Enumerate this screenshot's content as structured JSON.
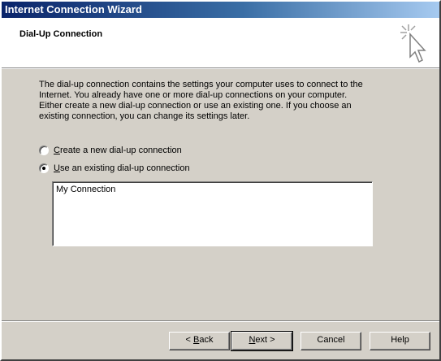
{
  "window": {
    "title": "Internet Connection Wizard"
  },
  "header": {
    "title": "Dial-Up Connection",
    "icon": "wizard-cursor-icon"
  },
  "intro": {
    "text": "The dial-up connection contains the settings your computer uses to connect to the Internet. You already have one or more dial-up connections on your computer. Either create a new dial-up connection or use an existing one. If you choose an existing connection, you can change its settings later."
  },
  "options": [
    {
      "accel": "C",
      "rest": "reate a new dial-up connection",
      "checked": false
    },
    {
      "accel": "U",
      "rest": "se an existing dial-up connection",
      "checked": true
    }
  ],
  "connections": [
    "My Connection"
  ],
  "buttons": {
    "back_prefix": "< ",
    "back_accel": "B",
    "back_rest": "ack",
    "next_accel": "N",
    "next_rest": "ext >",
    "cancel": "Cancel",
    "help": "Help"
  }
}
